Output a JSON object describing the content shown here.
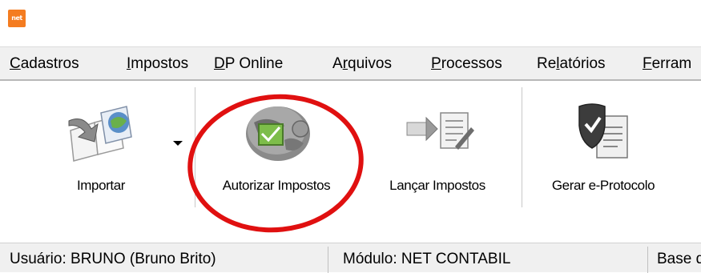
{
  "app": {
    "logo_text": "net"
  },
  "menu": {
    "items": [
      {
        "label": "Cadastros",
        "accel": "C",
        "rest": "adastros"
      },
      {
        "label": "Impostos",
        "accel": "I",
        "rest": "mpostos"
      },
      {
        "label": "DP Online",
        "accel": "D",
        "rest": "P Online"
      },
      {
        "label": "Arquivos",
        "pre": "A",
        "accel": "r",
        "rest": "quivos"
      },
      {
        "label": "Processos",
        "accel": "P",
        "rest": "rocessos"
      },
      {
        "label": "Relatórios",
        "pre": "Re",
        "accel": "l",
        "rest": "atórios"
      },
      {
        "label": "Ferramentas",
        "accel": "F",
        "rest": "erram"
      }
    ]
  },
  "ribbon": {
    "buttons": [
      {
        "label": "Importar",
        "icon": "import-icon"
      },
      {
        "label": "Autorizar Impostos",
        "icon": "authorize-taxes-icon"
      },
      {
        "label": "Lançar Impostos",
        "icon": "post-taxes-icon"
      },
      {
        "label": "Gerar e-Protocolo",
        "icon": "generate-protocol-icon"
      }
    ],
    "highlight_color": "#e01010"
  },
  "status": {
    "user": "Usuário: BRUNO (Bruno Brito)",
    "module": "Módulo: NET CONTABIL",
    "base": "Base d"
  }
}
